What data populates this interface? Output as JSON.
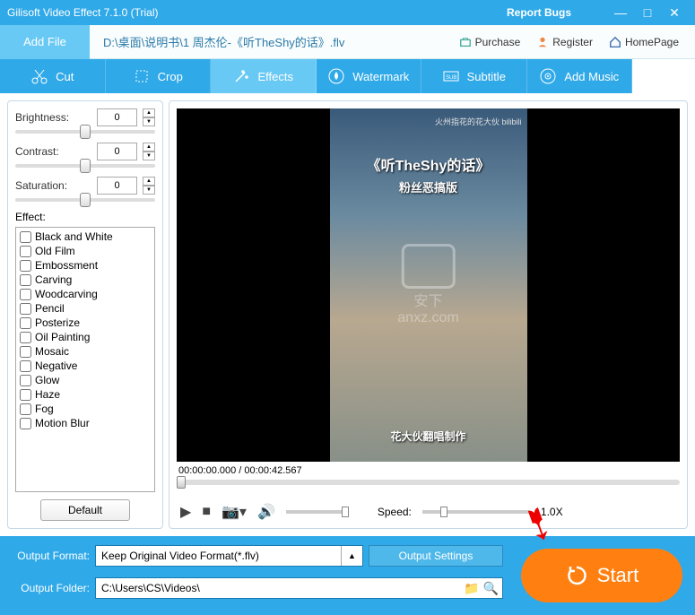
{
  "title": "Gilisoft Video Effect 7.1.0 (Trial)",
  "report_bugs": "Report Bugs",
  "toolbar": {
    "add_file": "Add File",
    "file_path": "D:\\桌面\\说明书\\1 周杰伦-《听TheShy的话》.flv",
    "purchase": "Purchase",
    "register": "Register",
    "homepage": "HomePage"
  },
  "tabs": {
    "cut": "Cut",
    "crop": "Crop",
    "effects": "Effects",
    "watermark": "Watermark",
    "subtitle": "Subtitle",
    "add_music": "Add Music"
  },
  "sliders": {
    "brightness": {
      "label": "Brightness:",
      "value": "0"
    },
    "contrast": {
      "label": "Contrast:",
      "value": "0"
    },
    "saturation": {
      "label": "Saturation:",
      "value": "0"
    }
  },
  "effect_label": "Effect:",
  "effects": [
    "Black and White",
    "Old Film",
    "Embossment",
    "Carving",
    "Woodcarving",
    "Pencil",
    "Posterize",
    "Oil Painting",
    "Mosaic",
    "Negative",
    "Glow",
    "Haze",
    "Fog",
    "Motion Blur"
  ],
  "default_btn": "Default",
  "video": {
    "toptext": "火州指花的花大伙 bilibili",
    "title1": "《听TheShy的话》",
    "title2": "粉丝恶搞版",
    "title3": "花大伙翻唱制作",
    "watermark": "anxz.com"
  },
  "time": {
    "current": "00:00:00.000",
    "total": "00:00:42.567"
  },
  "speed": {
    "label": "Speed:",
    "value": "1.0X"
  },
  "bottom": {
    "format_label": "Output Format:",
    "format_value": "Keep Original Video Format(*.flv)",
    "settings_btn": "Output Settings",
    "folder_label": "Output Folder:",
    "folder_value": "C:\\Users\\CS\\Videos\\",
    "start": "Start"
  }
}
